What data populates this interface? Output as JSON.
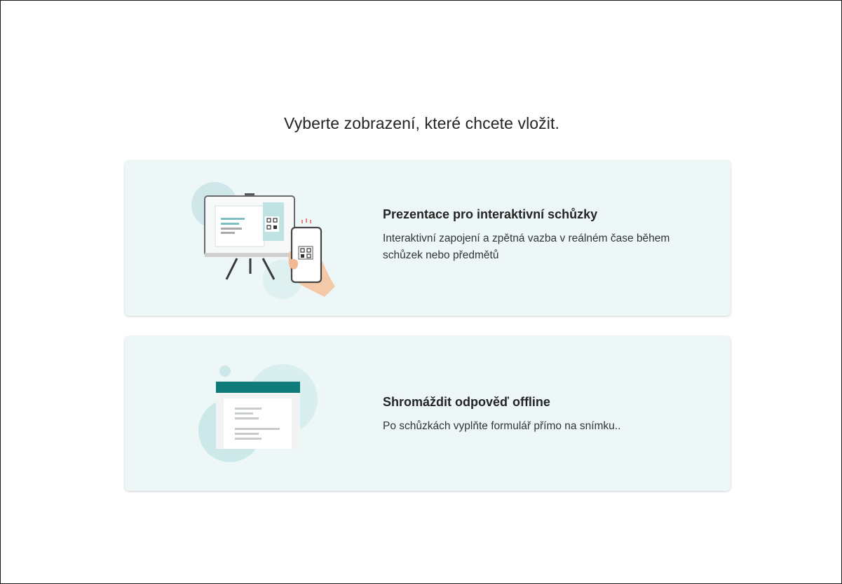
{
  "heading": "Vyberte zobrazení, které chcete vložit.",
  "options": [
    {
      "title": "Prezentace pro interaktivní schůzky",
      "description": "Interaktivní zapojení a zpětná vazba v reálném čase během schůzek nebo předmětů",
      "icon": "presentation-easel-phone-icon"
    },
    {
      "title": "Shromáždit odpověď offline",
      "description": "Po schůzkách vyplňte formulář přímo na snímku..",
      "icon": "offline-form-icon"
    }
  ],
  "colors": {
    "card_background": "#eef7f8",
    "accent_teal": "#0f7b7b",
    "light_teal": "#cde8e8"
  }
}
